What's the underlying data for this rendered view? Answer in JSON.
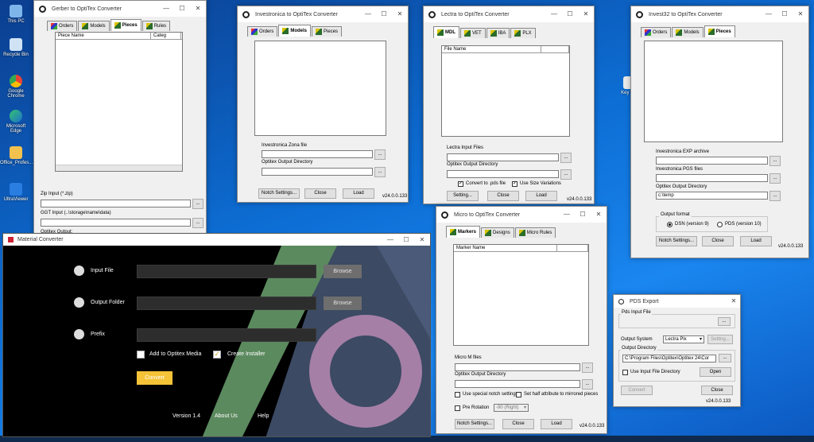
{
  "desktop": {
    "icons": [
      {
        "label": "This PC"
      },
      {
        "label": "Recycle Bin"
      },
      {
        "label": "Google Chrome"
      },
      {
        "label": "Microsoft Edge"
      },
      {
        "label": "Office_Profes..."
      },
      {
        "label": "UltraViewer"
      },
      {
        "label": "Key O..."
      }
    ]
  },
  "gerber": {
    "title": "Gerber to OptiTex Converter",
    "tabs": [
      "Orders",
      "Models",
      "Pieces",
      "Rules"
    ],
    "active_tab": "Pieces",
    "columns": [
      "Piece Name",
      "Categ"
    ],
    "zip_label": "Zip Input (*.zip)",
    "ggt_label": "GGT Input (..\\storage\\name\\data)",
    "output_label": "Optitex Output:",
    "browse": "..."
  },
  "investronica": {
    "title": "Investronica to OptiTex Converter",
    "tabs": [
      "Orders",
      "Models",
      "Pieces"
    ],
    "active_tab": "Models",
    "zona_label": "Investronica Zona file",
    "output_label": "Optitex Output Directory",
    "notch": "Notch Settings...",
    "close": "Close",
    "load": "Load",
    "version": "v24.0.0.133",
    "browse": "..."
  },
  "lectra": {
    "title": "Lectra to OptiTex Converter",
    "tabs": [
      "MDL",
      "VET",
      "IBA",
      "PLX"
    ],
    "active_tab": "MDL",
    "column": "File Name",
    "input_label": "Lectra Input Files",
    "output_label": "Optitex Output Directory",
    "convert_pds": "Convert to .pds file",
    "size_var": "Use Size Variations",
    "setting": "Setting...",
    "close": "Close",
    "load": "Load",
    "version": "v24.0.0.133",
    "browse": "..."
  },
  "invest32": {
    "title": "Invest32 to OptiTex Converter",
    "tabs": [
      "Orders",
      "Models",
      "Pieces"
    ],
    "active_tab": "Pieces",
    "exp_label": "Investronica EXP archive",
    "pgs_label": "Investronica PGS files",
    "output_label": "Optitex Output Directory",
    "output_value": "c:\\temp",
    "format_label": "Output format",
    "dsn": "DSN (version 9)",
    "pds": "PDS (version 10)",
    "notch": "Notch Settings...",
    "close": "Close",
    "load": "Load",
    "version": "v24.0.0.133",
    "browse": "..."
  },
  "micro": {
    "title": "Micro to OptiTex Converter",
    "tabs": [
      "Markers",
      "Designs",
      "Micro Rules"
    ],
    "active_tab": "Markers",
    "column": "Marker Name",
    "files_label": "Micro M files",
    "output_label": "Optitex Output Directory",
    "special_notch": "Use special notch setting",
    "half_attr": "Set half attribute to mirrored pieces",
    "pre_rotation": "Pre Rotation",
    "rotation_value": "-90 (Right)",
    "notch": "Notch Settings...",
    "close": "Close",
    "load": "Load",
    "version": "v24.0.0.133",
    "browse": "..."
  },
  "pds": {
    "title": "PDS Export",
    "input_label": "Pds Input File",
    "system_label": "Output System",
    "system_value": "Lectra Plx",
    "setting": "Setting...",
    "dir_label": "Output Directory",
    "dir_value": "C:\\Program Files\\Optitex\\Optitex 24\\Cor",
    "use_input": "Use Input File Directory",
    "open": "Open",
    "convert": "Convert",
    "close": "Close",
    "version": "v24.0.0.133",
    "browse": "..."
  },
  "material": {
    "title": "Material Converter",
    "input_file": "Input File",
    "output_folder": "Output Folder",
    "prefix": "Prefix",
    "browse": "Browse",
    "add_media": "Add to Optitex Media",
    "create_installer": "Create Installer",
    "convert": "Convert",
    "version": "Version 1.4",
    "about": "About Us",
    "help": "Help",
    "colors": {
      "accent": "#f5c338",
      "green": "#5b8a5e",
      "slate": "#3c4a63",
      "pink": "#a57fa6"
    }
  },
  "window_controls": {
    "min": "—",
    "max": "☐",
    "close": "✕"
  }
}
